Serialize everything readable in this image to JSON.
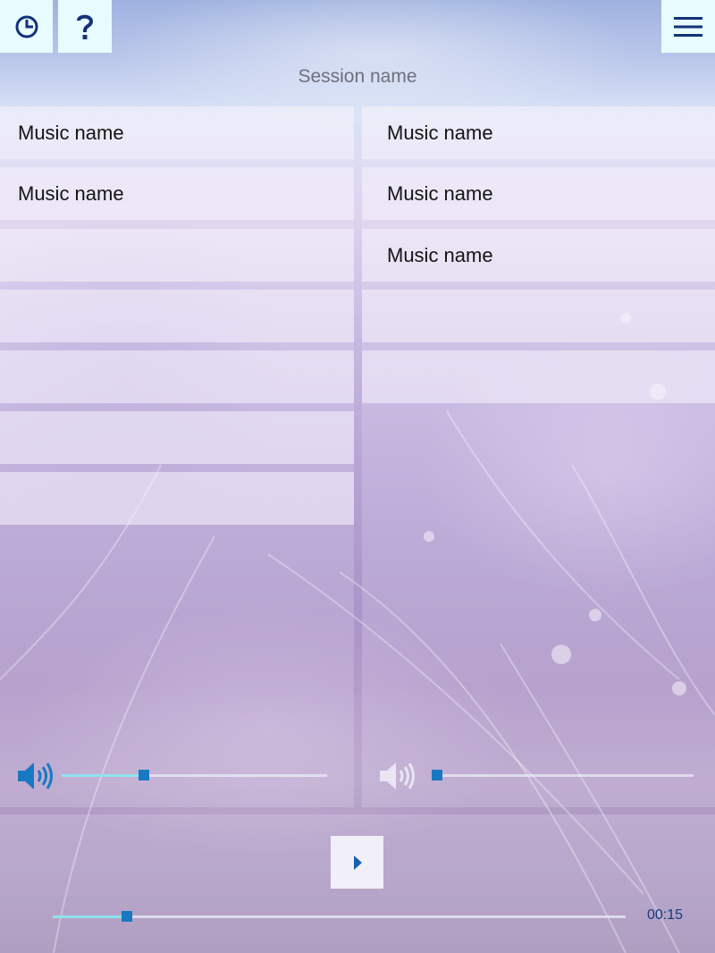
{
  "header": {
    "session_name": "Session name",
    "icons": {
      "clock": "clock-icon",
      "help": "help-icon",
      "menu": "hamburger-menu-icon"
    }
  },
  "left_panel": {
    "rows": [
      {
        "label": "Music name"
      },
      {
        "label": "Music name"
      },
      {
        "label": ""
      },
      {
        "label": ""
      },
      {
        "label": ""
      },
      {
        "label": ""
      },
      {
        "label": ""
      }
    ],
    "volume": 0.31
  },
  "right_panel": {
    "rows": [
      {
        "label": "Music name"
      },
      {
        "label": "Music name"
      },
      {
        "label": "Music name"
      },
      {
        "label": ""
      },
      {
        "label": ""
      }
    ],
    "volume": 0.02
  },
  "player": {
    "icon": "play-icon",
    "progress": 0.13,
    "time": "00:15"
  },
  "colors": {
    "accent": "#1878c2",
    "slider_fill": "#8fe3f0",
    "top_button_bg": "#e8fbff",
    "time_text": "#133b83"
  }
}
